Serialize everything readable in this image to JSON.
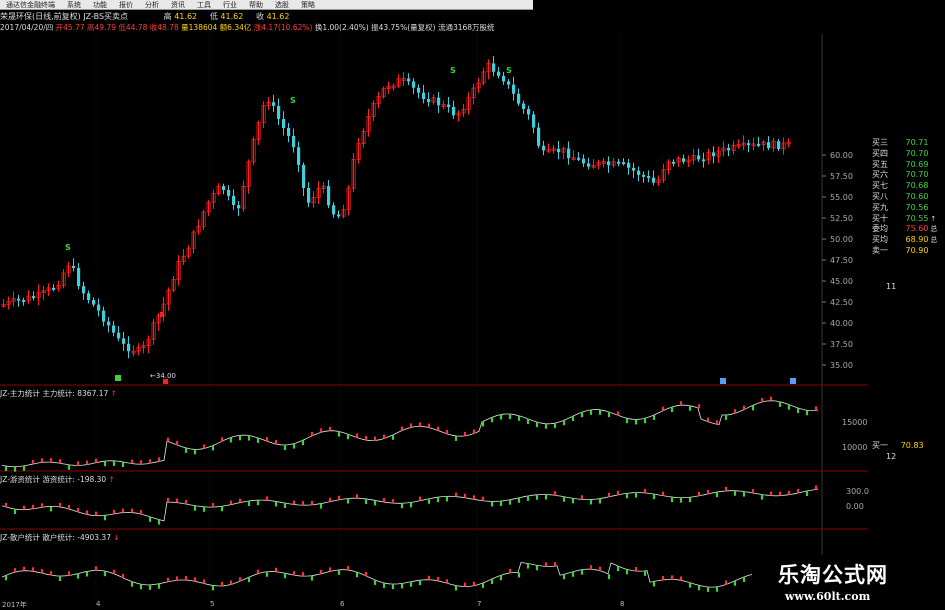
{
  "menu": [
    "通达信金融终端",
    "系统",
    "功能",
    "报价",
    "分析",
    "资讯",
    "工具",
    "行业",
    "帮助",
    "选股",
    "策略"
  ],
  "info": {
    "title": "荣晟环保(日线,前复权) JZ-BS买卖点",
    "h_label": "高",
    "h_val": "41.62",
    "l_label": "低",
    "l_val": "41.62",
    "c_label": "收",
    "c_val": "41.62",
    "line2_date": "2017/04/20/四",
    "line2_open": "开45.77",
    "line2_high": "高49.79",
    "line2_low": "低44.78",
    "line2_close": "收48.78",
    "line2_vol": "量138604",
    "line2_amt": "额6.34亿",
    "line2_chg": "涨4.17(10.62%)",
    "line2_turn": "换1.00(2.40%)",
    "line2_amp": "振43.75%(量复权)",
    "line2_float": "流通3168万股统"
  },
  "price_axis": [
    "60.00",
    "57.50",
    "55.00",
    "52.50",
    "50.00",
    "47.50",
    "45.00",
    "42.50",
    "40.00",
    "37.50",
    "35.00"
  ],
  "price_low_label": "34.00",
  "order_book": [
    {
      "label": "买三",
      "value": "70.71",
      "ext": ""
    },
    {
      "label": "买四",
      "value": "70.70",
      "ext": ""
    },
    {
      "label": "买五",
      "value": "70.69",
      "ext": ""
    },
    {
      "label": "买六",
      "value": "70.70",
      "ext": ""
    },
    {
      "label": "买七",
      "value": "70.68",
      "ext": ""
    },
    {
      "label": "买八",
      "value": "70.60",
      "ext": ""
    },
    {
      "label": "买九",
      "value": "70.56",
      "ext": ""
    },
    {
      "label": "买十",
      "value": "70.55",
      "ext": "↑"
    },
    {
      "label": "委均",
      "value": "75.60",
      "ext": "总"
    },
    {
      "label": "买均",
      "value": "68.90",
      "ext": "总"
    },
    {
      "label": "卖一",
      "value": "70.90",
      "ext": ""
    }
  ],
  "book_side_qty": "11",
  "panels": [
    {
      "title": "JZ-主力统计",
      "label": "主力统计:",
      "value": "8367.17",
      "ticks": [
        "15000",
        "10000"
      ]
    },
    {
      "title": "JZ-游资统计",
      "label": "游资统计:",
      "value": "-198.30",
      "ticks": [
        "300.0",
        "0.00"
      ]
    },
    {
      "title": "JZ-散户统计",
      "label": "散户统计:",
      "value": "-4903.37",
      "ticks": []
    }
  ],
  "panel1_side": {
    "label": "买一",
    "value": "70.83",
    "qty": "12"
  },
  "time_axis": [
    "2017年",
    "4",
    "5",
    "6",
    "7",
    "8"
  ],
  "watermark": {
    "title": "乐淘公式网",
    "url": "www.60lt.com"
  },
  "colors": {
    "up": "#ff2020",
    "down": "#3fd0e0",
    "bg": "#000000",
    "grid": "#2a2a2a"
  }
}
